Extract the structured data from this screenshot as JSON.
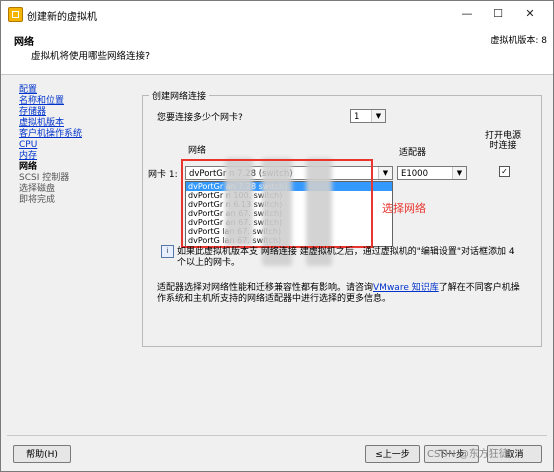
{
  "window": {
    "title": "创建新的虚拟机"
  },
  "header": {
    "title": "网络",
    "subtitle": "虚拟机将使用哪些网络连接?",
    "version": "虚拟机版本: 8"
  },
  "nav": [
    {
      "label": "配置",
      "state": "link"
    },
    {
      "label": "名称和位置",
      "state": "link"
    },
    {
      "label": "存储器",
      "state": "link"
    },
    {
      "label": "虚拟机版本",
      "state": "link"
    },
    {
      "label": "客户机操作系统",
      "state": "link"
    },
    {
      "label": "CPU",
      "state": "link"
    },
    {
      "label": "内存",
      "state": "link"
    },
    {
      "label": "网络",
      "state": "current"
    },
    {
      "label": "SCSI 控制器",
      "state": "future"
    },
    {
      "label": "选择磁盘",
      "state": "future"
    },
    {
      "label": "即将完成",
      "state": "future"
    }
  ],
  "group": {
    "legend": "创建网络连接"
  },
  "nic_count": {
    "label": "您要连接多少个网卡?",
    "value": "1"
  },
  "columns": {
    "network": "网络",
    "adapter": "适配器",
    "power_on": "打开电源\n时连接"
  },
  "nic1": {
    "label": "网卡 1:",
    "network_value": "dvPortGr                    n          7.28     (switch)",
    "adapter_value": "E1000",
    "connect_checked": "✓"
  },
  "dropdown_options": [
    "dvPortGr        an         7.28      switch)",
    "dvPortGr          n       100.       switch)",
    "dvPortGr          n          6.13       switch)",
    "dvPortGr        an          67.         switch)",
    "dvPortGr        an          67.         switch)",
    "dvPortG         lan          67.        switch)",
    "dvPortG          lan          67.        switch)"
  ],
  "annotation": "选择网络",
  "info_text": "如果此虚拟机版本支        网络连接        建虚拟机之后，通过虚拟机的\"编辑设置\"对话框添加 4 个以上的网卡。",
  "adapter_note_pre": "适配器选择对网络性能和迁移兼容性都有影响。请咨询",
  "adapter_note_link": "VMware 知识库",
  "adapter_note_post": "了解在不同客户机操作系统和主机所支持的网络适配器中进行选择的更多信息。",
  "buttons": {
    "help": "帮助(H)",
    "back": "≤上一步",
    "next": "下一步",
    "cancel": "取消"
  },
  "watermark": "CSDN @东方狂徒",
  "colors": {
    "highlight": "#e8352e",
    "link": "#0033cc",
    "selection": "#3399ff"
  }
}
